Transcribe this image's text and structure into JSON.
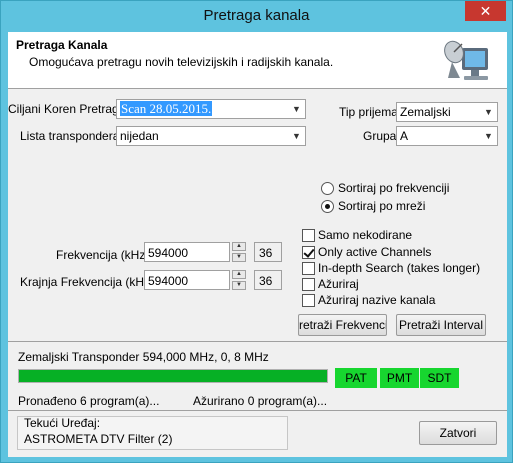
{
  "window": {
    "title": "Pretraga kanala",
    "close_glyph": "✕"
  },
  "header": {
    "title": "Pretraga Kanala",
    "description": "Omogućava pretragu novih televizijskih i radijskih kanala.",
    "icon": "satellite-dish-monitor-icon"
  },
  "form": {
    "target_root_label": "Ciljani Koren Pretrage",
    "target_root_value": "Scan 28.05.2015.",
    "transponder_list_label": "Lista transpondera",
    "transponder_list_value": "nijedan",
    "reception_type_label": "Tip prijema",
    "reception_type_value": "Zemaljski",
    "group_label": "Grupa",
    "group_value": "A"
  },
  "sort": {
    "by_frequency_label": "Sortiraj po frekvenciji",
    "by_frequency_selected": false,
    "by_network_label": "Sortiraj po mreži",
    "by_network_selected": true
  },
  "frequency": {
    "start_label": "Frekvencija (kHz)",
    "start_value": "594000",
    "start_channel": "36",
    "end_label": "Krajnja Frekvencija (kHz)",
    "end_value": "594000",
    "end_channel": "36"
  },
  "options": [
    {
      "label": "Samo nekodirane",
      "checked": false
    },
    {
      "label": "Only active Channels",
      "checked": true
    },
    {
      "label": "In-depth Search (takes longer)",
      "checked": false
    },
    {
      "label": "Ažuriraj",
      "checked": false
    },
    {
      "label": "Ažuriraj nazive kanala",
      "checked": false
    }
  ],
  "buttons": {
    "scan_frequency": "retraži Frekvenciju",
    "scan_interval": "Pretraži Interval",
    "close": "Zatvori"
  },
  "status": {
    "transponder_text": "Zemaljski Transponder 594,000 MHz, 0, 8 MHz",
    "progress_percent": 100,
    "tags": [
      "PAT",
      "PMT",
      "SDT"
    ],
    "tag_color": "#17d62f",
    "found_text": "Pronađeno 6 program(a)...",
    "updated_text": "Ažurirano 0 program(a)..."
  },
  "device": {
    "label": "Tekući Uređaj:",
    "value": "ASTROMETA DTV Filter (2)"
  }
}
